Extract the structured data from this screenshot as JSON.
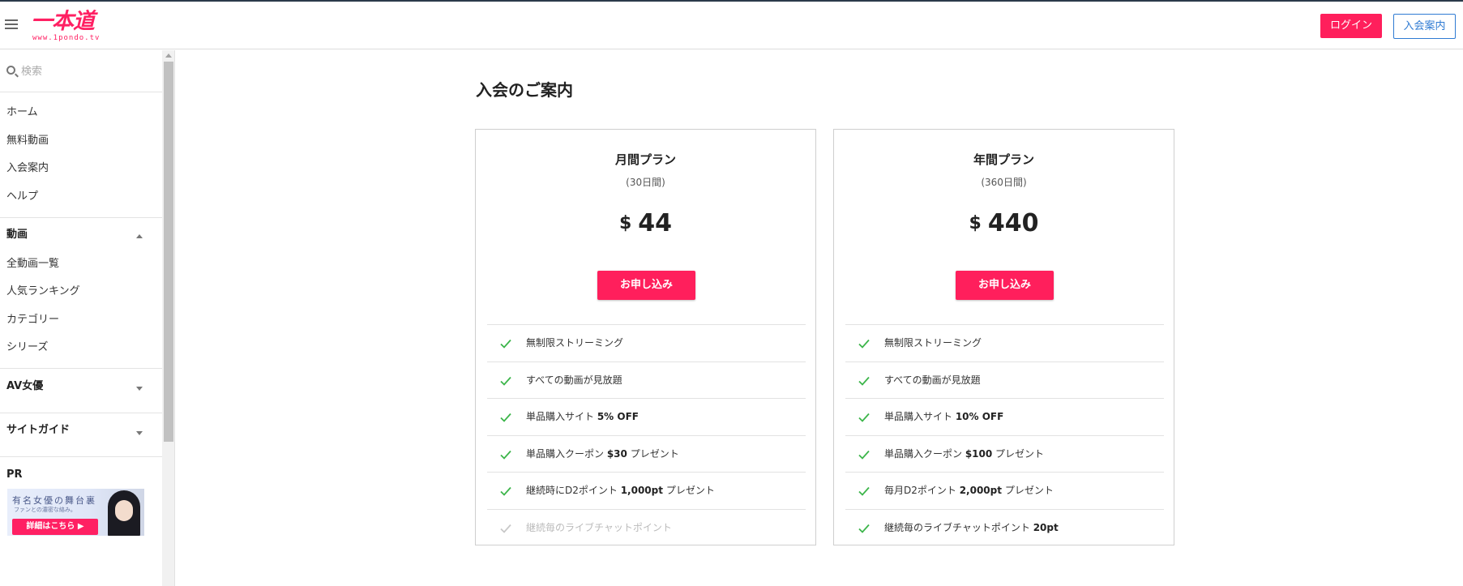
{
  "header": {
    "logo_mark": "一本道",
    "logo_url": "www.1pondo.tv",
    "login_label": "ログイン",
    "join_label": "入会案内"
  },
  "sidebar": {
    "search_placeholder": "検索",
    "nav": [
      "ホーム",
      "無料動画",
      "入会案内",
      "ヘルプ"
    ],
    "video_section": {
      "title": "動画",
      "expanded": true,
      "items": [
        "全動画一覧",
        "人気ランキング",
        "カテゴリー",
        "シリーズ"
      ]
    },
    "actress_section": {
      "title": "AV女優",
      "expanded": false
    },
    "guide_section": {
      "title": "サイトガイド",
      "expanded": false
    },
    "pr": {
      "title": "PR",
      "banner_title": "有名女優の舞台裏",
      "banner_sub": "ファンとの濃密な絡み。",
      "banner_button": "詳細はこちら"
    }
  },
  "main": {
    "title": "入会のご案内",
    "plans": [
      {
        "name": "月間プラン",
        "period": "(30日間)",
        "currency": "$",
        "price": "44",
        "button": "お申し込み",
        "features": [
          {
            "pre": "無制限ストリーミング",
            "bold": "",
            "post": "",
            "enabled": true
          },
          {
            "pre": "すべての動画が見放題",
            "bold": "",
            "post": "",
            "enabled": true
          },
          {
            "pre": "単品購入サイト ",
            "bold": "5% OFF",
            "post": "",
            "enabled": true
          },
          {
            "pre": "単品購入クーポン ",
            "bold": "$30",
            "post": " プレゼント",
            "enabled": true
          },
          {
            "pre": "継続時にD2ポイント ",
            "bold": "1,000pt",
            "post": " プレゼント",
            "enabled": true
          },
          {
            "pre": "継続毎のライブチャットポイント",
            "bold": "",
            "post": "",
            "enabled": false
          }
        ]
      },
      {
        "name": "年間プラン",
        "period": "(360日間)",
        "currency": "$",
        "price": "440",
        "button": "お申し込み",
        "features": [
          {
            "pre": "無制限ストリーミング",
            "bold": "",
            "post": "",
            "enabled": true
          },
          {
            "pre": "すべての動画が見放題",
            "bold": "",
            "post": "",
            "enabled": true
          },
          {
            "pre": "単品購入サイト ",
            "bold": "10% OFF",
            "post": "",
            "enabled": true
          },
          {
            "pre": "単品購入クーポン ",
            "bold": "$100",
            "post": " プレゼント",
            "enabled": true
          },
          {
            "pre": "毎月D2ポイント ",
            "bold": "2,000pt",
            "post": " プレゼント",
            "enabled": true
          },
          {
            "pre": "継続毎のライブチャットポイント ",
            "bold": "20pt",
            "post": "",
            "enabled": true
          }
        ]
      }
    ]
  },
  "colors": {
    "brand_pink": "#ff1f5c",
    "join_blue": "#2f7bd3",
    "check_green": "#3cb54a",
    "check_disabled": "#c8c8c8"
  }
}
